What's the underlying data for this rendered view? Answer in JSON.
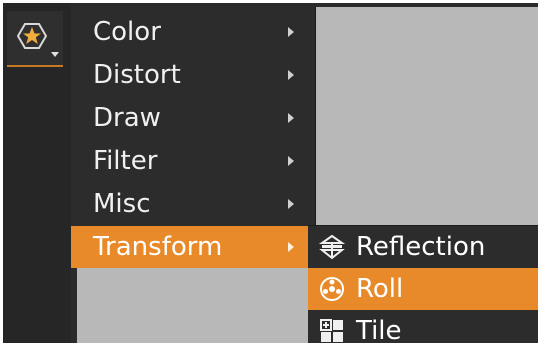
{
  "toolbar": {
    "tool_icon": "effects-icon",
    "caret_icon": "chevron-down-icon"
  },
  "menu": {
    "items": [
      {
        "label": "Color",
        "submenu_arrow": true
      },
      {
        "label": "Distort",
        "submenu_arrow": true
      },
      {
        "label": "Draw",
        "submenu_arrow": true
      },
      {
        "label": "Filter",
        "submenu_arrow": true
      },
      {
        "label": "Misc",
        "submenu_arrow": true
      },
      {
        "label": "Transform",
        "submenu_arrow": true,
        "active": true
      }
    ]
  },
  "submenu": {
    "items": [
      {
        "label": "Reflection",
        "icon": "reflection-icon"
      },
      {
        "label": "Roll",
        "icon": "roll-icon",
        "active": true
      },
      {
        "label": "Tile",
        "icon": "tile-icon"
      }
    ]
  },
  "colors": {
    "accent": "#e98a2a",
    "menu_bg": "#2c2c2c",
    "canvas_bg": "#b8b8b8",
    "text": "#f0f0f0"
  }
}
